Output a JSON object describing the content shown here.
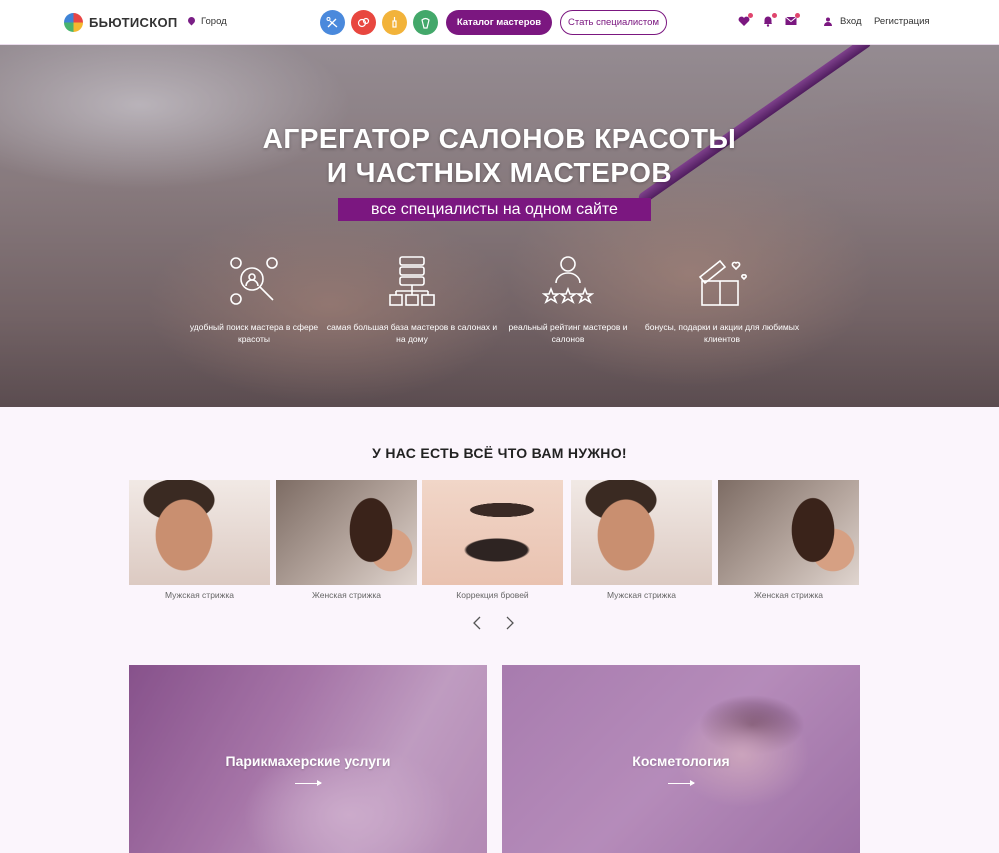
{
  "header": {
    "brand": "БЬЮТИСКОП",
    "city": "Город",
    "catalog_button": "Каталог мастеров",
    "become_button": "Стать специалистом",
    "login": "Вход",
    "register": "Регистрация",
    "category_icons": [
      "scissors-icon",
      "makeup-icon",
      "nail-icon",
      "cosmetology-icon"
    ]
  },
  "hero": {
    "title_line1": "АГРЕГАТОР САЛОНОВ КРАСОТЫ",
    "title_line2": "И ЧАСТНЫХ МАСТЕРОВ",
    "subtitle": "все специалисты на одном сайте",
    "features": [
      {
        "icon": "search-users-icon",
        "text": "удобный поиск мастера в сфере красоты"
      },
      {
        "icon": "database-icon",
        "text": "самая большая база мастеров в салонах и на дому"
      },
      {
        "icon": "rating-icon",
        "text": "реальный рейтинг мастеров и салонов"
      },
      {
        "icon": "gift-icon",
        "text": "бонусы, подарки и акции для любимых клиентов"
      }
    ]
  },
  "services": {
    "title": "У НАС ЕСТЬ ВСЁ ЧТО ВАМ НУЖНО!",
    "items": [
      {
        "label": "Мужская стрижка"
      },
      {
        "label": "Женская стрижка"
      },
      {
        "label": "Коррекция бровей"
      },
      {
        "label": "Мужская стрижка"
      },
      {
        "label": "Женская стрижка"
      }
    ]
  },
  "banners": [
    {
      "title": "Парикмахерские услуги"
    },
    {
      "title": "Косметология"
    }
  ],
  "colors": {
    "accent": "#7b1780",
    "background": "#fbf5fc"
  }
}
